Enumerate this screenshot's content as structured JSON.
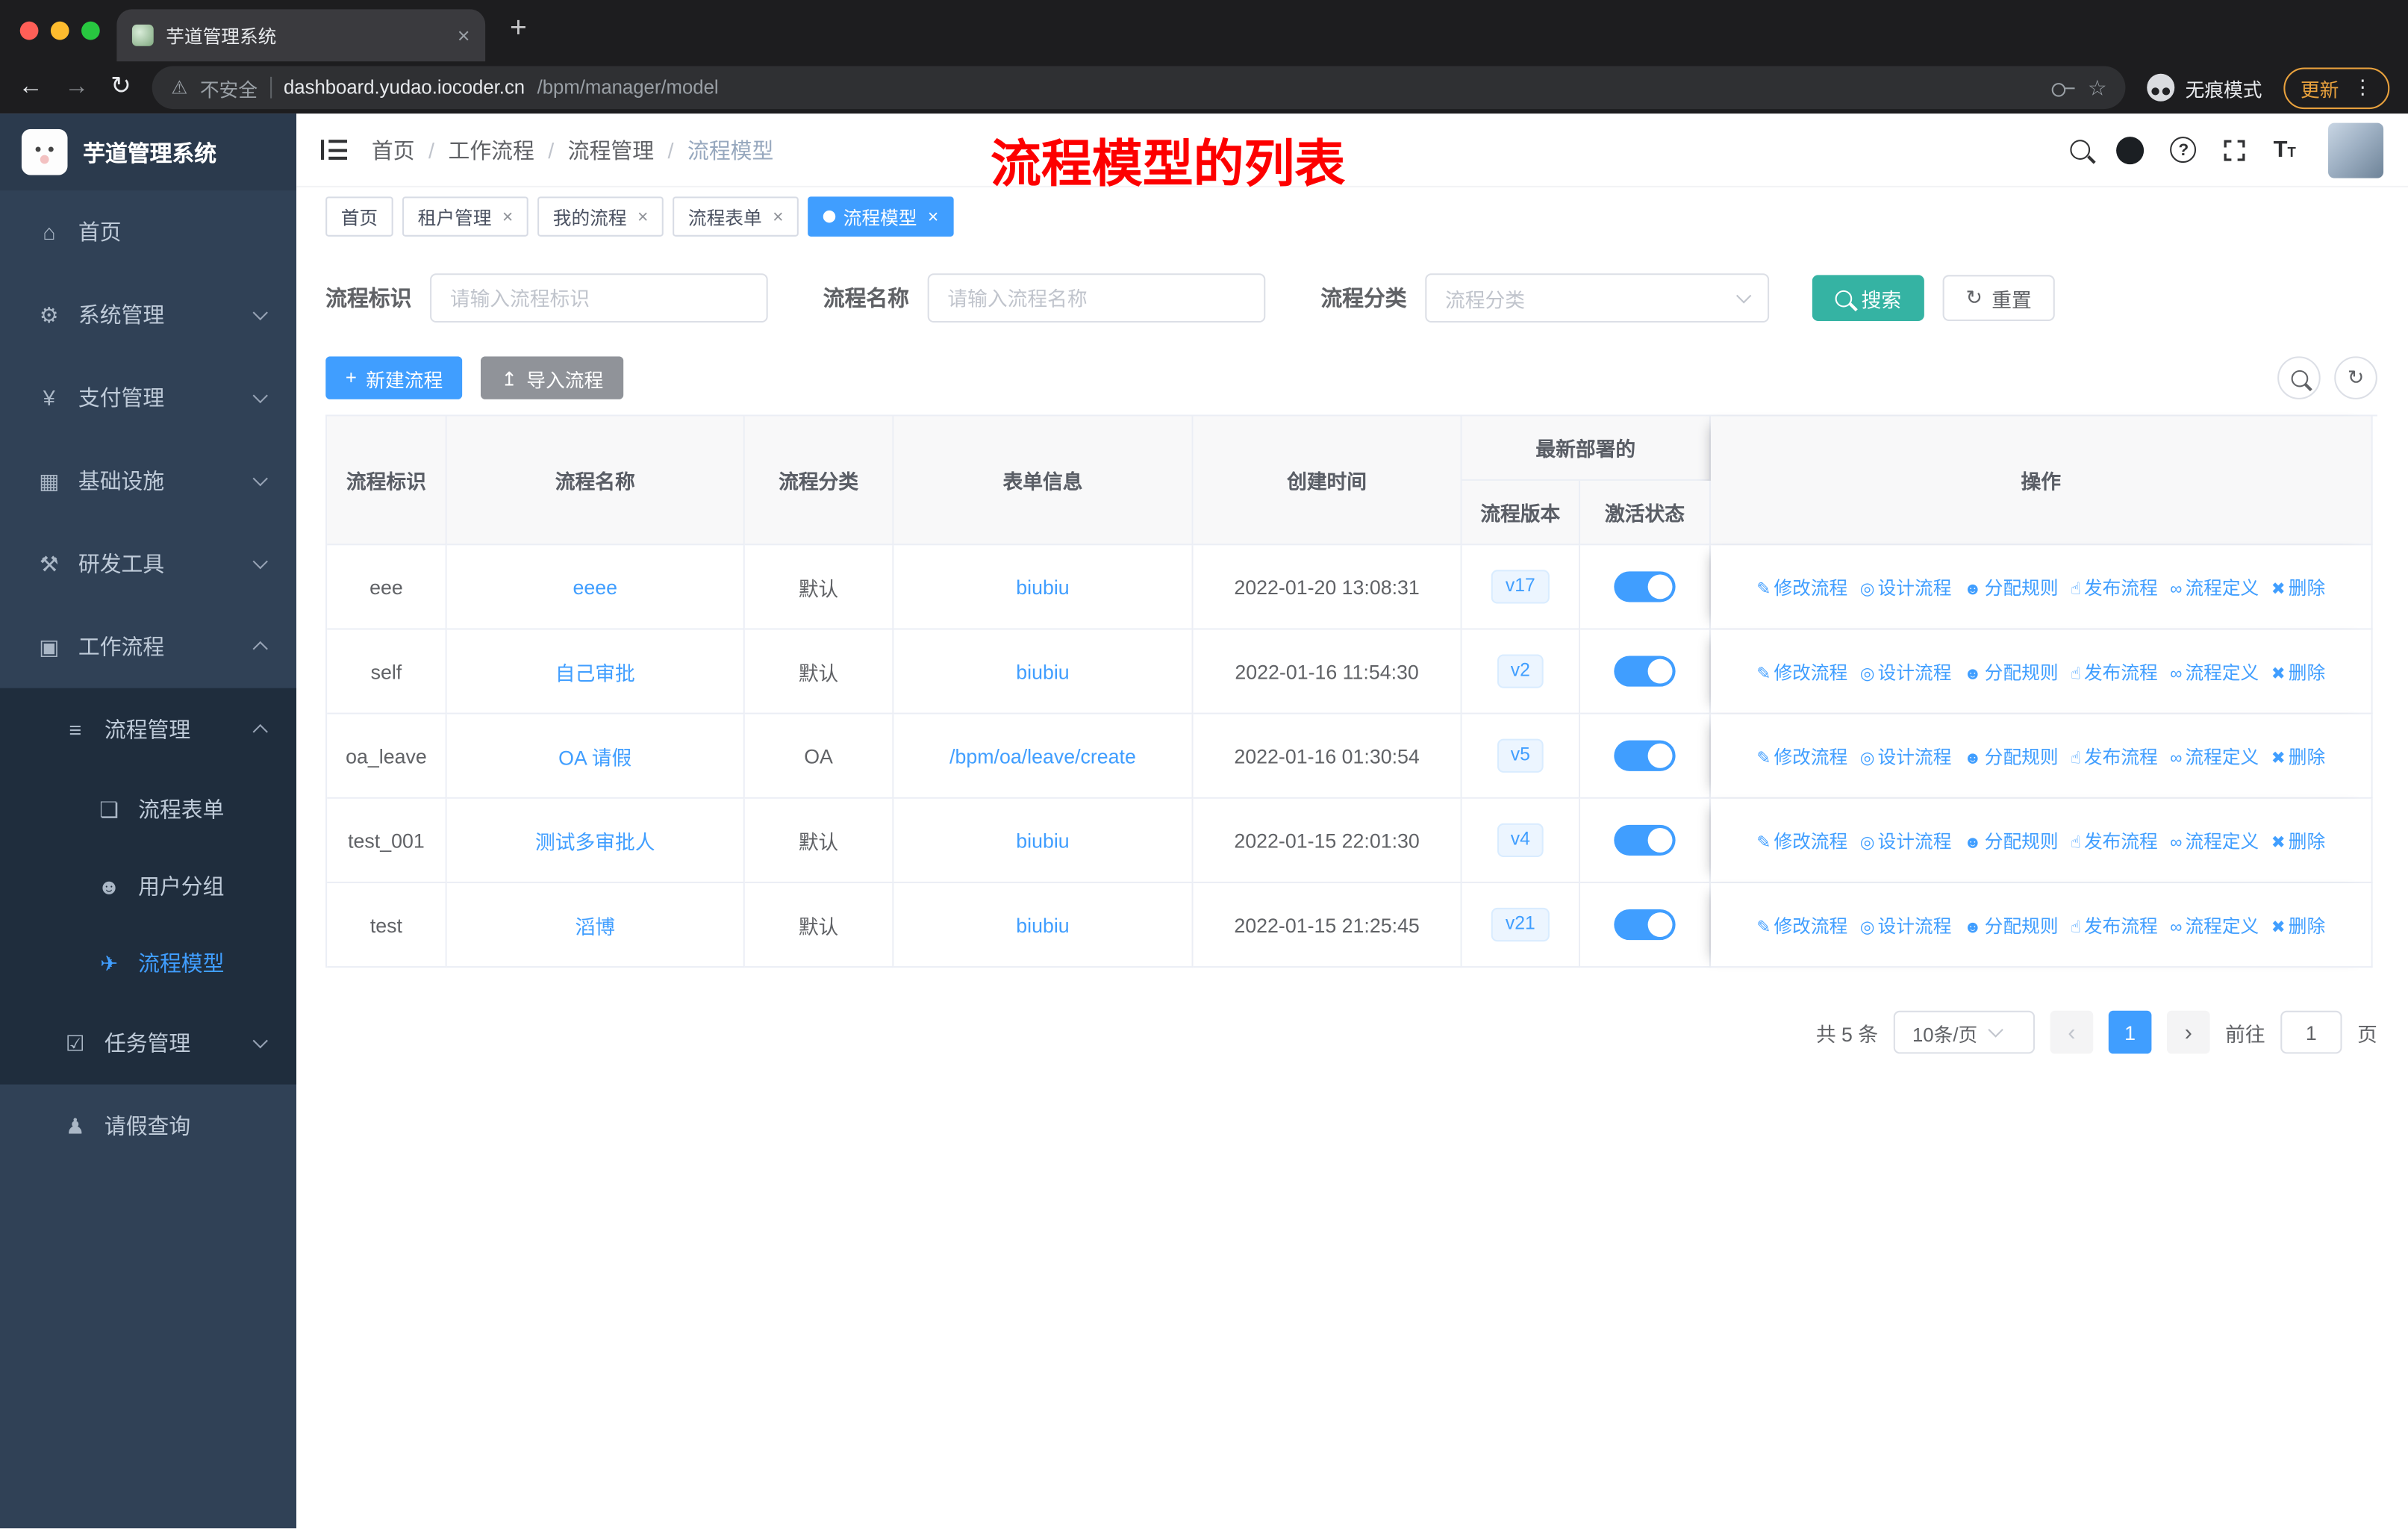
{
  "browser": {
    "tab_title": "芋道管理系统",
    "security_label": "不安全",
    "url_host": "dashboard.yudao.iocoder.cn",
    "url_path": "/bpm/manager/model",
    "incognito_label": "无痕模式",
    "update_label": "更新"
  },
  "icons": {
    "back": "←",
    "forward": "→",
    "reload": "↻",
    "warning": "⚠",
    "star": "☆",
    "dots": "⋮",
    "tab_close": "×",
    "new_tab": "+",
    "home": "⌂",
    "system": "⚙",
    "payment": "¥",
    "infra": "▦",
    "devtools": "⚒",
    "workflow": "▣",
    "process_mgmt": "≡",
    "process_form": "❏",
    "user_group": "☻",
    "process_model": "✈",
    "task_mgmt": "☑",
    "leave_query": "♟",
    "plus": "+",
    "import": "↥",
    "reset": "↻",
    "refresh": "↻",
    "edit": "✎",
    "design": "◎",
    "assign": "☻",
    "publish": "☝",
    "definition": "∞",
    "delete": "✖",
    "prev": "‹",
    "next": "›"
  },
  "sidebar": {
    "logo_title": "芋道管理系统",
    "menu": {
      "home": "首页",
      "system": "系统管理",
      "payment": "支付管理",
      "infra": "基础设施",
      "devtools": "研发工具",
      "workflow": "工作流程",
      "process_mgmt": "流程管理",
      "process_form": "流程表单",
      "user_group": "用户分组",
      "process_model": "流程模型",
      "task_mgmt": "任务管理",
      "leave_query": "请假查询"
    }
  },
  "header": {
    "breadcrumb": [
      "首页",
      "工作流程",
      "流程管理",
      "流程模型"
    ],
    "annotation": "流程模型的列表"
  },
  "tags": {
    "items": [
      {
        "label": "首页"
      },
      {
        "label": "租户管理"
      },
      {
        "label": "我的流程"
      },
      {
        "label": "流程表单"
      },
      {
        "label": "流程模型"
      }
    ]
  },
  "filters": {
    "id_label": "流程标识",
    "id_placeholder": "请输入流程标识",
    "name_label": "流程名称",
    "name_placeholder": "请输入流程名称",
    "category_label": "流程分类",
    "category_placeholder": "流程分类",
    "search_label": "搜索",
    "reset_label": "重置"
  },
  "toolbar": {
    "create_label": "新建流程",
    "import_label": "导入流程"
  },
  "table": {
    "headers": {
      "id": "流程标识",
      "name": "流程名称",
      "category": "流程分类",
      "form": "表单信息",
      "created": "创建时间",
      "deploy_group": "最新部署的",
      "version": "流程版本",
      "active": "激活状态",
      "actions": "操作"
    },
    "row_actions": [
      "修改流程",
      "设计流程",
      "分配规则",
      "发布流程",
      "流程定义",
      "删除"
    ],
    "rows": [
      {
        "id": "eee",
        "name": "eeee",
        "category": "默认",
        "form": "biubiu",
        "created": "2022-01-20 13:08:31",
        "version": "v17",
        "active": true
      },
      {
        "id": "self",
        "name": "自己审批",
        "category": "默认",
        "form": "biubiu",
        "created": "2022-01-16 11:54:30",
        "version": "v2",
        "active": true
      },
      {
        "id": "oa_leave",
        "name": "OA 请假",
        "category": "OA",
        "form": "/bpm/oa/leave/create",
        "created": "2022-01-16 01:30:54",
        "version": "v5",
        "active": true
      },
      {
        "id": "test_001",
        "name": "测试多审批人",
        "category": "默认",
        "form": "biubiu",
        "created": "2022-01-15 22:01:30",
        "version": "v4",
        "active": true
      },
      {
        "id": "test",
        "name": "滔博",
        "category": "默认",
        "form": "biubiu",
        "created": "2022-01-15 21:25:45",
        "version": "v21",
        "active": true
      }
    ]
  },
  "pagination": {
    "total": "共 5 条",
    "page_size": "10条/页",
    "current_page": "1",
    "goto_label": "前往",
    "goto_value": "1",
    "page_unit": "页"
  }
}
